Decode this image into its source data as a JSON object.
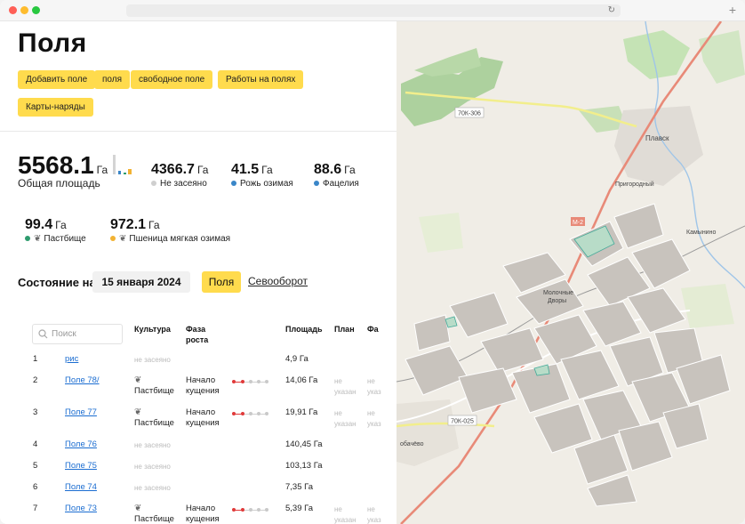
{
  "page": {
    "title": "Поля"
  },
  "toolbar": {
    "add_field": "Добавить поле",
    "fields": "поля",
    "free_field": "свободное поле",
    "field_works": "Работы на полях",
    "work_orders": "Карты-наряды"
  },
  "summary": {
    "total": {
      "value": "5568.1",
      "unit": "Га",
      "label": "Общая площадь"
    },
    "items": [
      {
        "value": "4366.7",
        "unit": "Га",
        "label": "Не засеяно",
        "color": "#cfcfcf"
      },
      {
        "value": "41.5",
        "unit": "Га",
        "label": "Рожь озимая",
        "color": "#3a86c8"
      },
      {
        "value": "88.6",
        "unit": "Га",
        "label": "Фацелия",
        "color": "#3a86c8"
      },
      {
        "value": "99.4",
        "unit": "Га",
        "label": "Пастбище",
        "color": "#2e9b6e"
      },
      {
        "value": "972.1",
        "unit": "Га",
        "label": "Пшеница мягкая озимая",
        "color": "#f2b233"
      }
    ]
  },
  "state": {
    "label": "Состояние на",
    "date": "15 января 2024",
    "tab_active": "Поля",
    "tab_other": "Севооборот"
  },
  "table": {
    "search_placeholder": "Поиск",
    "headers": {
      "culture": "Культура",
      "phase_1": "Фаза",
      "phase_2": "роста",
      "area": "Площадь",
      "plan": "План",
      "fact": "Фа"
    },
    "not_sown": "не засеяно",
    "not_specified_1": "не",
    "not_specified_2": "указан",
    "not_specified_2_cut": "указ",
    "rows": [
      {
        "num": "1",
        "name": "рис",
        "culture": "",
        "phase_1": "",
        "phase_2": "",
        "area": "4,9 Га"
      },
      {
        "num": "2",
        "name": "Поле 78/",
        "culture": "Пастбище",
        "phase_1": "Начало",
        "phase_2": "кущения",
        "area": "14,06 Га"
      },
      {
        "num": "3",
        "name": "Поле 77",
        "culture": "Пастбище",
        "phase_1": "Начало",
        "phase_2": "кущения",
        "area": "19,91 Га"
      },
      {
        "num": "4",
        "name": "Поле 76",
        "culture": "",
        "phase_1": "",
        "phase_2": "",
        "area": "140,45 Га"
      },
      {
        "num": "5",
        "name": "Поле 75",
        "culture": "",
        "phase_1": "",
        "phase_2": "",
        "area": "103,13 Га"
      },
      {
        "num": "6",
        "name": "Поле 74",
        "culture": "",
        "phase_1": "",
        "phase_2": "",
        "area": "7,35 Га"
      },
      {
        "num": "7",
        "name": "Поле 73",
        "culture": "Пастбище",
        "phase_1": "Начало",
        "phase_2": "кущения",
        "area": "5,39 Га"
      }
    ]
  },
  "map": {
    "labels": {
      "plavsk": "Плавск",
      "prigorodny": "Пригородный",
      "kamynino": "Камынино",
      "molochnye_1": "Молочные",
      "molochnye_2": "Дворы",
      "road_70k306": "70К-306",
      "road_m2": "М-2",
      "road_70k025": "70К-025",
      "bobachevo": "обачёво"
    }
  }
}
